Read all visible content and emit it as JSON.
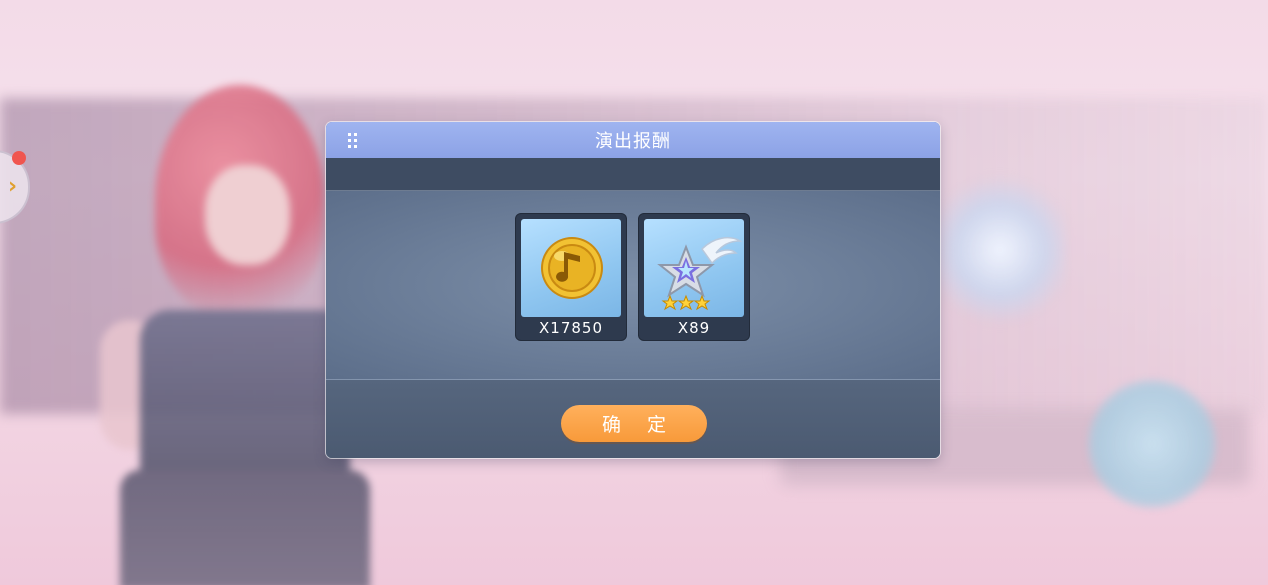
{
  "dialog": {
    "title": "演出报酬",
    "confirm_label": "确 定"
  },
  "rewards": [
    {
      "name": "music-coin",
      "icon": "music-note-coin-icon",
      "quantity": "X17850"
    },
    {
      "name": "winged-star",
      "icon": "winged-star-icon",
      "quantity": "X89",
      "stars": 3
    }
  ],
  "colors": {
    "header": "#8ca2e6",
    "button": "#f89a3a",
    "notification_dot": "#f0554f"
  }
}
